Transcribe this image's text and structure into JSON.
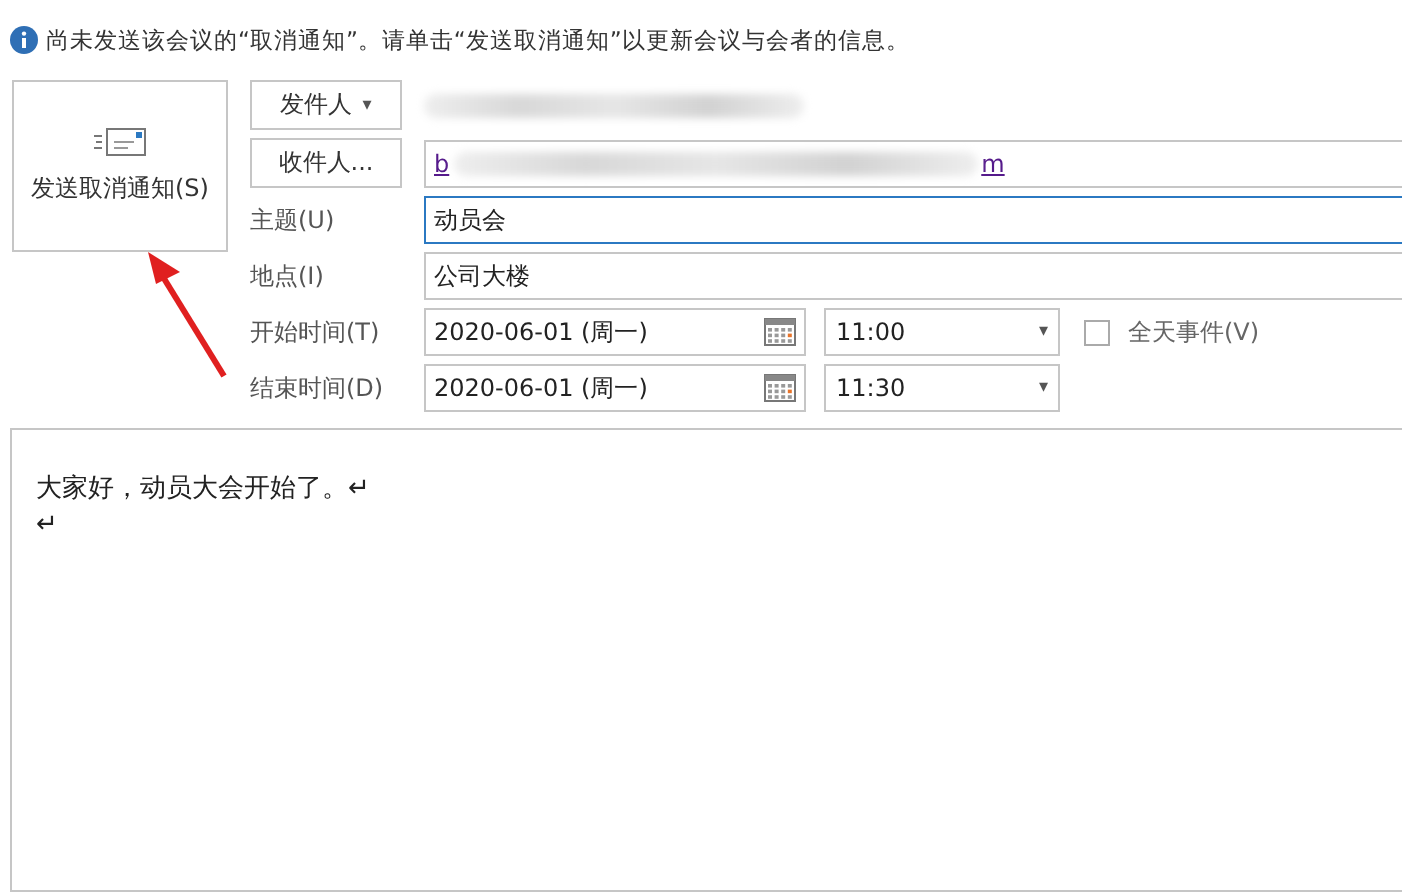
{
  "info_bar": {
    "text": "尚未发送该会议的“取消通知”。请单击“发送取消通知”以更新会议与会者的信息。"
  },
  "send_button": {
    "label": "发送取消通知(S)"
  },
  "sender_button": {
    "label": "发件人",
    "caret": "▾"
  },
  "recipient_button": {
    "label": "收件人..."
  },
  "recipient": {
    "start": "b",
    "end": "m"
  },
  "fields": [
    {
      "label": "主题(U)",
      "value": "动员会",
      "focused": true
    },
    {
      "label": "地点(I)",
      "value": "公司大楼",
      "focused": false
    }
  ],
  "times": [
    {
      "label": "开始时间(T)",
      "date": "2020-06-01 (周一)",
      "time": "11:00",
      "caret": "▾"
    },
    {
      "label": "结束时间(D)",
      "date": "2020-06-01 (周一)",
      "time": "11:30",
      "caret": "▾"
    }
  ],
  "all_day": {
    "label": "全天事件(V)",
    "checked": false
  },
  "body": {
    "lines": [
      "大家好，动员大会开始了。↵",
      "↵"
    ]
  }
}
